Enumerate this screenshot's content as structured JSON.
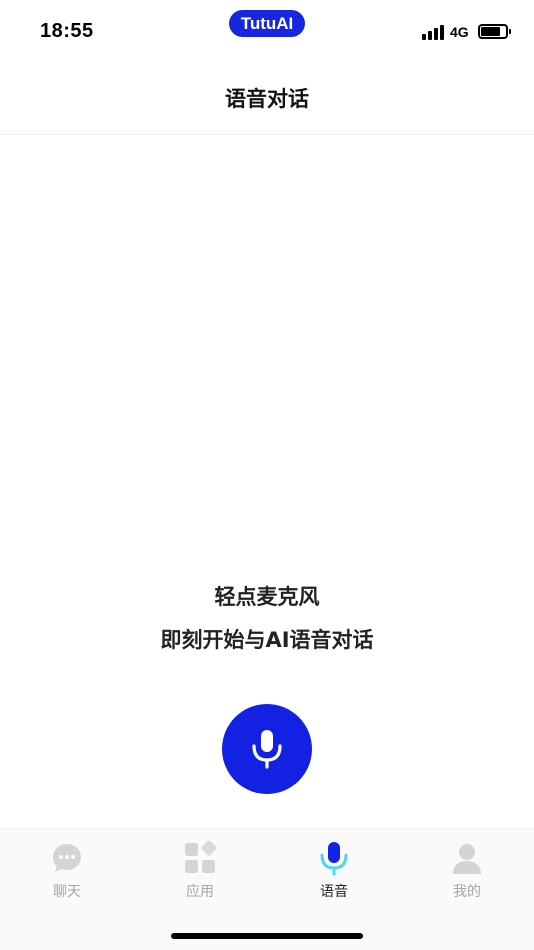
{
  "status_bar": {
    "time": "18:55",
    "app_badge": "TutuAI",
    "network": "4G",
    "battery_level": 0.78,
    "signal_bars": 4
  },
  "header": {
    "title": "语音对话"
  },
  "main": {
    "prompt_line1": "轻点麦克风",
    "prompt_line2": "即刻开始与AI语音对话",
    "mic_button_icon": "microphone-icon"
  },
  "tab_bar": {
    "tabs": [
      {
        "label": "聊天",
        "icon": "chat-bubble-icon",
        "active": false
      },
      {
        "label": "应用",
        "icon": "apps-grid-icon",
        "active": false
      },
      {
        "label": "语音",
        "icon": "microphone-icon",
        "active": true
      },
      {
        "label": "我的",
        "icon": "user-profile-icon",
        "active": false
      }
    ]
  },
  "colors": {
    "accent": "#1322e2",
    "accent_light": "#4fd6f0",
    "tab_inactive": "#a6a6a6",
    "tab_icon_inactive": "#d4d4d4"
  }
}
